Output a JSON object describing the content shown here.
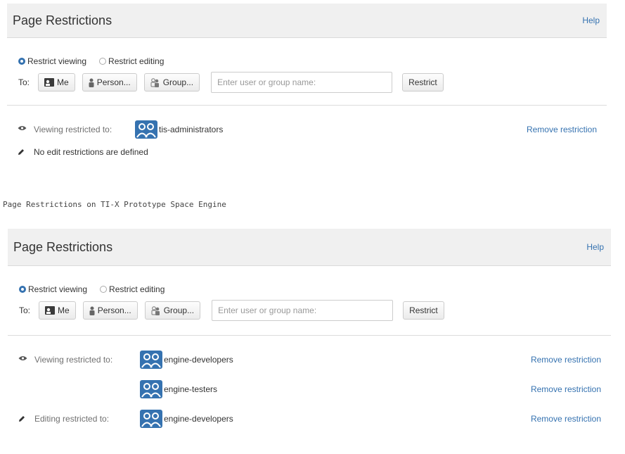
{
  "panel1": {
    "title": "Page Restrictions",
    "help": "Help",
    "radio_view": "Restrict viewing",
    "radio_edit": "Restrict editing",
    "to_label": "To:",
    "btn_me": "Me",
    "btn_person": "Person...",
    "btn_group": "Group...",
    "input_placeholder": "Enter user or group name:",
    "btn_restrict": "Restrict",
    "viewing_label": "Viewing restricted to:",
    "viewing_group": "tis-administrators",
    "remove": "Remove restriction",
    "no_edit": "No edit restrictions are defined"
  },
  "caption": "Page Restrictions on TI-X Prototype Space Engine",
  "panel2": {
    "title": "Page Restrictions",
    "help": "Help",
    "radio_view": "Restrict viewing",
    "radio_edit": "Restrict editing",
    "to_label": "To:",
    "btn_me": "Me",
    "btn_person": "Person...",
    "btn_group": "Group...",
    "input_placeholder": "Enter user or group name:",
    "btn_restrict": "Restrict",
    "viewing_label": "Viewing restricted to:",
    "view_groups": [
      "engine-developers",
      "engine-testers"
    ],
    "editing_label": "Editing restricted to:",
    "edit_group": "engine-developers",
    "remove": "Remove restriction"
  },
  "colors": {
    "link": "#3572b0",
    "group_icon": "#3572b0",
    "header_bg": "#f0f0f0"
  },
  "icons": [
    "eye-icon",
    "pencil-icon",
    "group-icon",
    "me-icon",
    "person-icon",
    "group-small-icon"
  ]
}
